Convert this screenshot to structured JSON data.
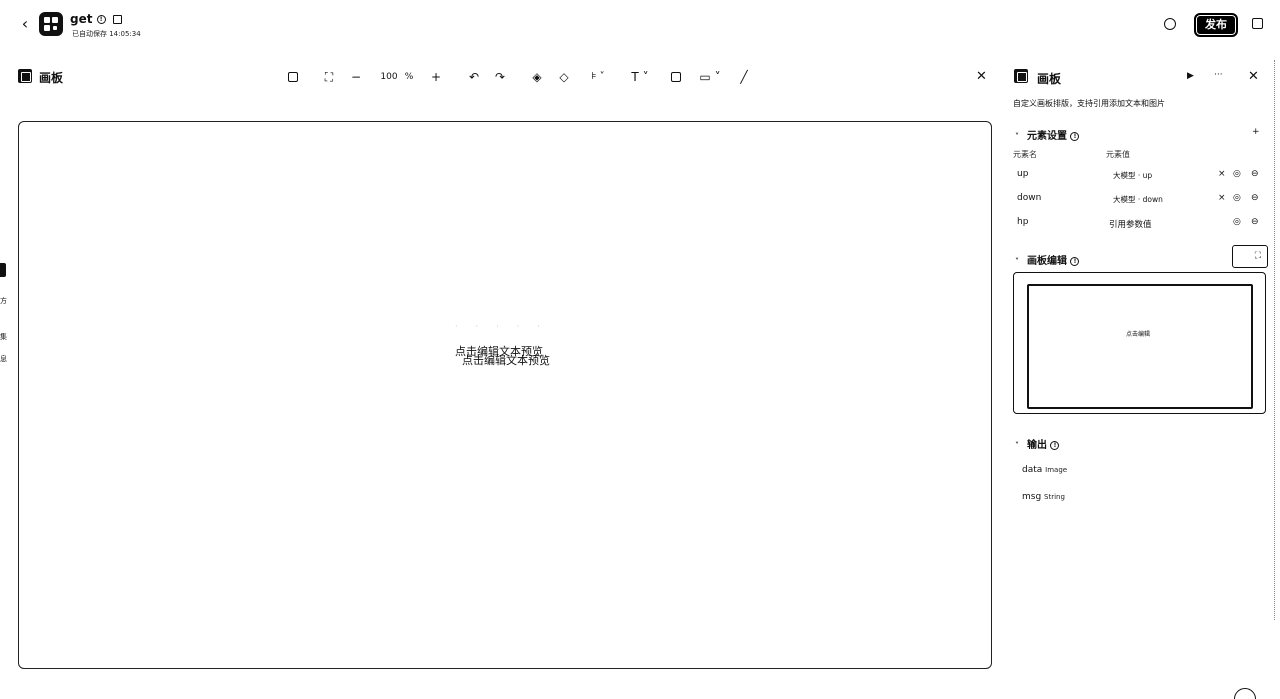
{
  "app": {
    "back_icon": "chevron-left-icon",
    "name": "get",
    "autosave": "已自动保存 14:05:34",
    "publish_label": "发布"
  },
  "canvas_panel": {
    "title": "画板",
    "zoom_value": "100",
    "zoom_unit": "%",
    "preview_text": "点击编辑文本预览",
    "preview_text_ghost": "点击编辑文本预览"
  },
  "toolbar_icons": [
    "copy-image-icon",
    "fit-screen-icon",
    "zoom-out-icon",
    "zoom-in-icon",
    "undo-icon",
    "redo-icon",
    "layer-up-icon",
    "layer-down-icon",
    "align-icon",
    "text-icon",
    "image-icon",
    "rectangle-icon",
    "pen-icon"
  ],
  "left_edge": {
    "chars": [
      "方",
      "集",
      "息"
    ]
  },
  "right_panel": {
    "title": "画板",
    "description": "自定义画板排版，支持引用添加文本和图片",
    "elements_section": {
      "title": "元素设置",
      "col_name": "元素名",
      "col_value": "元素值",
      "rows": [
        {
          "name": "up",
          "value": "大模型 · up"
        },
        {
          "name": "down",
          "value": "大模型 · down"
        },
        {
          "name": "hp",
          "value": "引用参数值"
        }
      ]
    },
    "board_edit_section": {
      "title": "画板编辑",
      "thumb_text": "点击编辑"
    },
    "output_section": {
      "title": "输出",
      "items": [
        {
          "name": "data",
          "type": "Image"
        },
        {
          "name": "msg",
          "type": "String"
        }
      ]
    }
  }
}
